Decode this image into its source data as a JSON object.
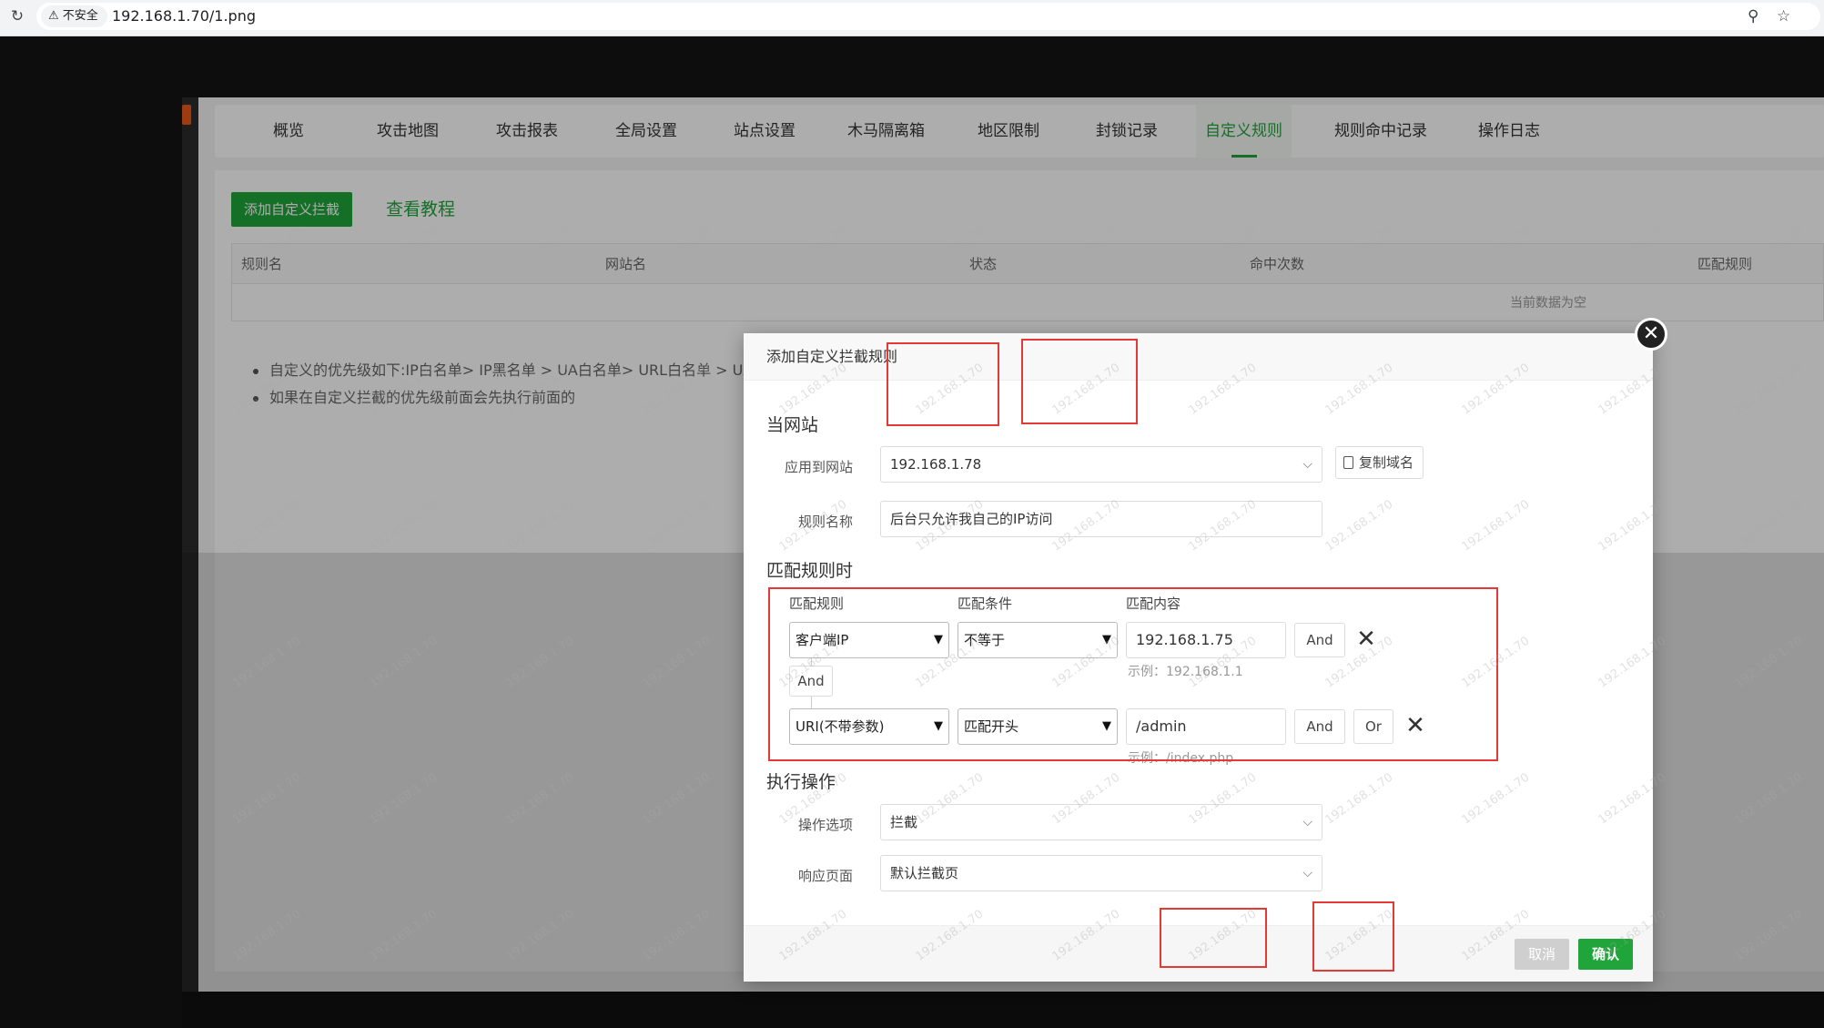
{
  "browser": {
    "insecure_label": "不安全",
    "url": "192.168.1.70/1.png",
    "reload_icon": "reload-icon",
    "zoom_icon": "zoom-icon",
    "star_icon": "star-icon"
  },
  "nav": {
    "tabs": [
      "概览",
      "攻击地图",
      "攻击报表",
      "全局设置",
      "站点设置",
      "木马隔离箱",
      "地区限制",
      "封锁记录",
      "自定义规则",
      "规则命中记录",
      "操作日志"
    ],
    "active_index": 8
  },
  "toolbar": {
    "add_label": "添加自定义拦截",
    "tutorial_label": "查看教程"
  },
  "table": {
    "columns": [
      "规则名",
      "网站名",
      "状态",
      "命中次数",
      "匹配规则"
    ],
    "empty_text": "当前数据为空"
  },
  "notes": [
    "自定义的优先级如下:IP白名单> IP黑名单 > UA白名单> URL白名单 > UA黑",
    "如果在自定义拦截的优先级前面会先执行前面的"
  ],
  "modal": {
    "title": "添加自定义拦截规则",
    "close_icon": "close-icon",
    "section_site": "当网站",
    "apply_label": "应用到网站",
    "apply_value": "192.168.1.78",
    "copy_label": "复制域名",
    "name_label": "规则名称",
    "name_value": "后台只允许我自己的IP访问",
    "section_match": "匹配规则时",
    "col_rule": "匹配规则",
    "col_cond": "匹配条件",
    "col_content": "匹配内容",
    "rules": [
      {
        "rule": "客户端IP",
        "cond": "不等于",
        "content": "192.168.1.75",
        "hint": "示例：192.168.1.1"
      },
      {
        "rule": "URI(不带参数)",
        "cond": "匹配开头",
        "content": "/admin",
        "hint": "示例：/index.php"
      }
    ],
    "and_label": "And",
    "or_label": "Or",
    "section_action": "执行操作",
    "action_label": "操作选项",
    "action_value": "拦截",
    "response_label": "响应页面",
    "response_value": "默认拦截页",
    "cancel_label": "取消",
    "confirm_label": "确认"
  },
  "watermark": "192.168.1.70",
  "colors": {
    "accent": "#20a53a",
    "annotation": "#e53935"
  }
}
